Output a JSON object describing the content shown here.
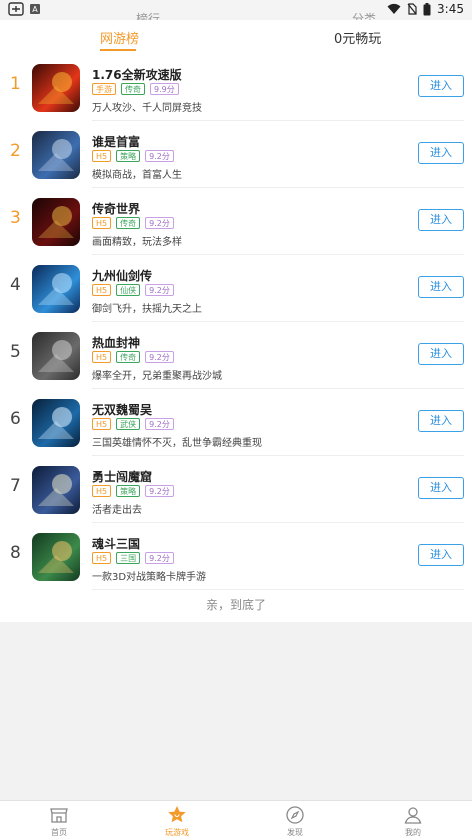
{
  "statusbar": {
    "time": "3:45",
    "ghost_left": "榜行",
    "ghost_right": "分类"
  },
  "tabs": [
    {
      "label": "网游榜",
      "active": true
    },
    {
      "label": "0元畅玩",
      "active": false
    }
  ],
  "enter_label": "进入",
  "games": [
    {
      "rank": "1",
      "name": "1.76全新攻速版",
      "tags": [
        "手游",
        "传奇",
        "9.9分"
      ],
      "desc": "万人攻沙、千人同屏竞技",
      "icon": "flame-sword-game-icon",
      "colors": [
        "#3a0a05",
        "#e3361a",
        "#f7b733"
      ]
    },
    {
      "rank": "2",
      "name": "谁是首富",
      "tags": [
        "H5",
        "策略",
        "9.2分"
      ],
      "desc": "模拟商战，首富人生",
      "icon": "businessman-game-icon",
      "colors": [
        "#1b2a44",
        "#3d6eb0",
        "#c9d8ea"
      ]
    },
    {
      "rank": "3",
      "name": "传奇世界",
      "tags": [
        "H5",
        "传奇",
        "9.2分"
      ],
      "desc": "画面精致，玩法多样",
      "icon": "legend-calligraphy-game-icon",
      "colors": [
        "#1a0505",
        "#6b0f0f",
        "#e0b240"
      ]
    },
    {
      "rank": "4",
      "name": "九州仙剑传",
      "tags": [
        "H5",
        "仙侠",
        "9.2分"
      ],
      "desc": "御剑飞升，扶摇九天之上",
      "icon": "flying-sword-game-icon",
      "colors": [
        "#0b2a5a",
        "#2f8fd8",
        "#bfe6ff"
      ]
    },
    {
      "rank": "5",
      "name": "热血封神",
      "tags": [
        "H5",
        "传奇",
        "9.2分"
      ],
      "desc": "爆率全开，兄弟重聚再战沙城",
      "icon": "stone-characters-game-icon",
      "colors": [
        "#2b2b2b",
        "#6a6a6a",
        "#cfcfcf"
      ]
    },
    {
      "rank": "6",
      "name": "无双魏蜀吴",
      "tags": [
        "H5",
        "武侠",
        "9.2分"
      ],
      "desc": "三国英雄情怀不灭，乱世争霸经典重现",
      "icon": "horse-rider-game-icon",
      "colors": [
        "#06203a",
        "#1e6aa8",
        "#dff0ff"
      ]
    },
    {
      "rank": "7",
      "name": "勇士闯魔窟",
      "tags": [
        "H5",
        "策略",
        "9.2分"
      ],
      "desc": "活者走出去",
      "icon": "warrior-moon-game-icon",
      "colors": [
        "#0d1c38",
        "#3a5a9a",
        "#e9e7c8"
      ]
    },
    {
      "rank": "8",
      "name": "魂斗三国",
      "tags": [
        "H5",
        "三国",
        "9.2分"
      ],
      "desc": "一款3D对战策略卡牌手游",
      "icon": "three-kingdoms-heroes-game-icon",
      "colors": [
        "#123a20",
        "#3c8a4a",
        "#f2c36b"
      ]
    }
  ],
  "end_text": "亲，到底了",
  "bottom_nav": [
    {
      "label": "首页",
      "icon": "shop-icon",
      "active": false
    },
    {
      "label": "玩游戏",
      "icon": "star-icon",
      "active": true
    },
    {
      "label": "发现",
      "icon": "compass-icon",
      "active": false
    },
    {
      "label": "我的",
      "icon": "user-icon",
      "active": false
    }
  ]
}
